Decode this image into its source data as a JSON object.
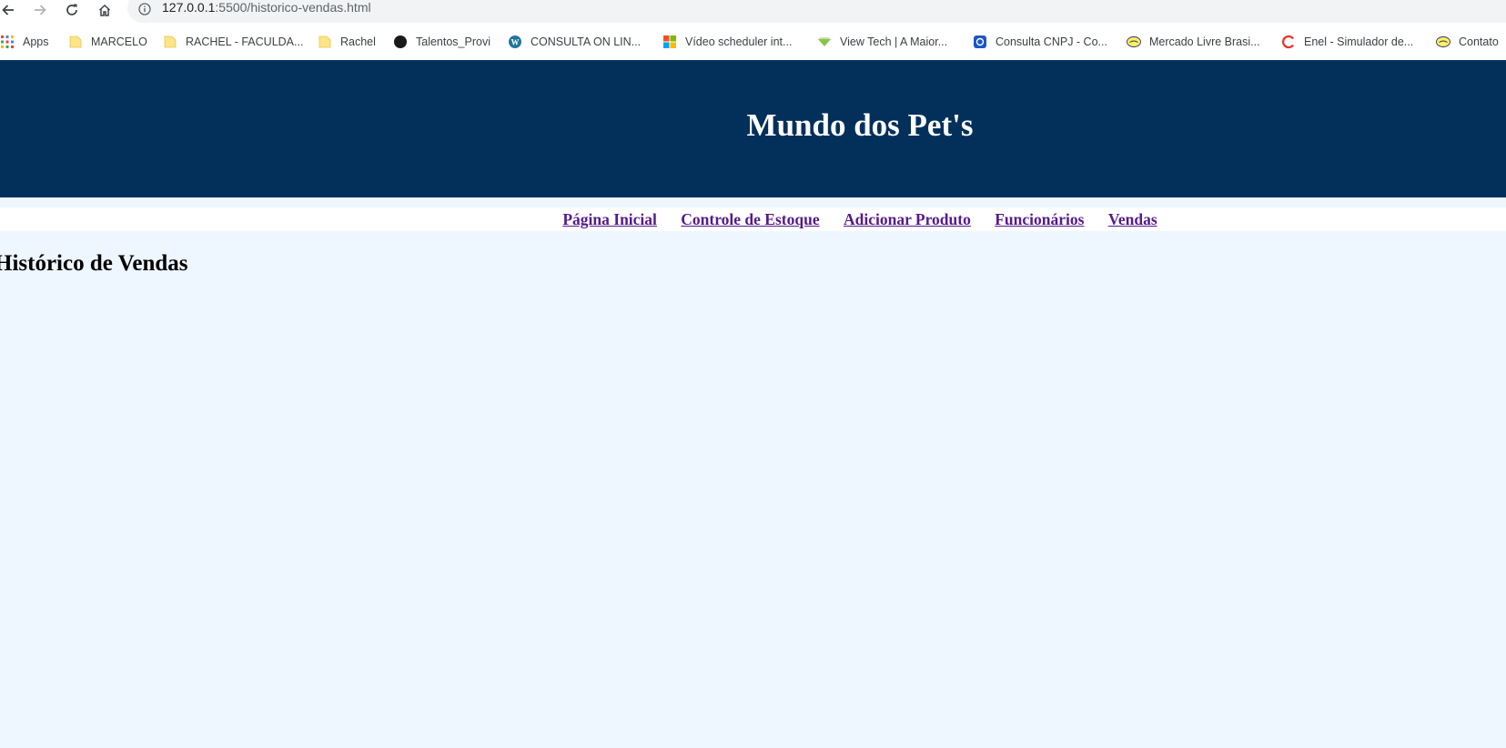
{
  "browser": {
    "url_host": "127.0.0.1",
    "url_path": ":5500/historico-vendas.html",
    "bookmarks": [
      {
        "label": "Apps",
        "icon": "apps-grid-icon"
      },
      {
        "label": "MARCELO",
        "icon": "folder-icon"
      },
      {
        "label": "RACHEL - FACULDA...",
        "icon": "folder-icon"
      },
      {
        "label": "Rachel",
        "icon": "folder-icon"
      },
      {
        "label": "Talentos_Provi",
        "icon": "dark-circle-icon"
      },
      {
        "label": "CONSULTA ON LIN...",
        "icon": "wordpress-icon"
      },
      {
        "label": "Vídeo scheduler int...",
        "icon": "microsoft-icon"
      },
      {
        "label": "View Tech | A Maior...",
        "icon": "viewtech-icon"
      },
      {
        "label": "Consulta CNPJ - Co...",
        "icon": "cnpj-icon"
      },
      {
        "label": "Mercado Livre Brasi...",
        "icon": "mercadolivre-icon"
      },
      {
        "label": "Enel - Simulador de...",
        "icon": "enel-icon"
      },
      {
        "label": "Contato",
        "icon": "mercadolivre-icon"
      }
    ]
  },
  "site": {
    "title": "Mundo dos Pet's",
    "nav": [
      {
        "label": "Página Inicial"
      },
      {
        "label": "Controle de Estoque"
      },
      {
        "label": "Adicionar Produto"
      },
      {
        "label": "Funcionários"
      },
      {
        "label": "Vendas"
      }
    ],
    "heading": "Histórico de Vendas"
  },
  "colors": {
    "header_bg": "#03305a",
    "page_bg": "#eef6ff",
    "link": "#551a8b"
  }
}
